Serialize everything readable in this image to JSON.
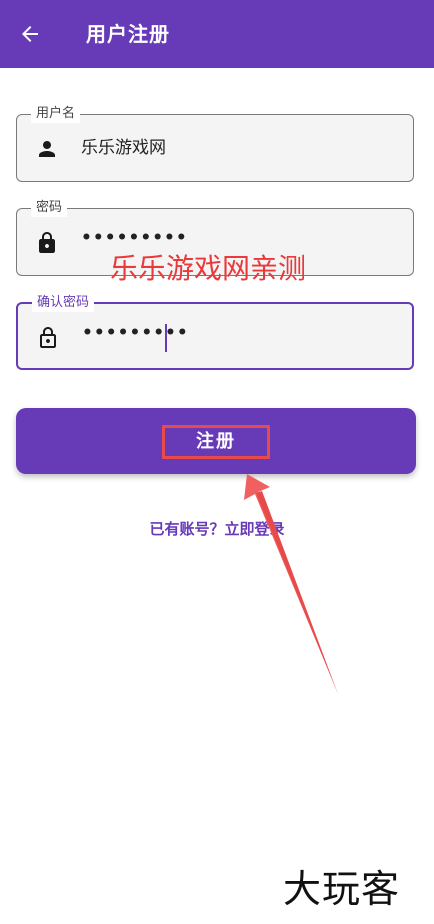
{
  "appbar": {
    "title": "用户注册"
  },
  "form": {
    "username": {
      "label": "用户名",
      "value": "乐乐游戏网",
      "icon": "person-icon"
    },
    "password": {
      "label": "密码",
      "value": "•••••••••",
      "icon": "lock-icon"
    },
    "confirm_password": {
      "label": "确认密码",
      "value": "•••••••••",
      "icon": "lock-open-icon"
    }
  },
  "watermark": "乐乐游戏网亲测",
  "register_button": {
    "label": "注册"
  },
  "login_link": "已有账号？立即登录",
  "corner_logo": "大玩客",
  "colors": {
    "primary": "#673ab7",
    "annotation_red": "#e84a4a"
  }
}
